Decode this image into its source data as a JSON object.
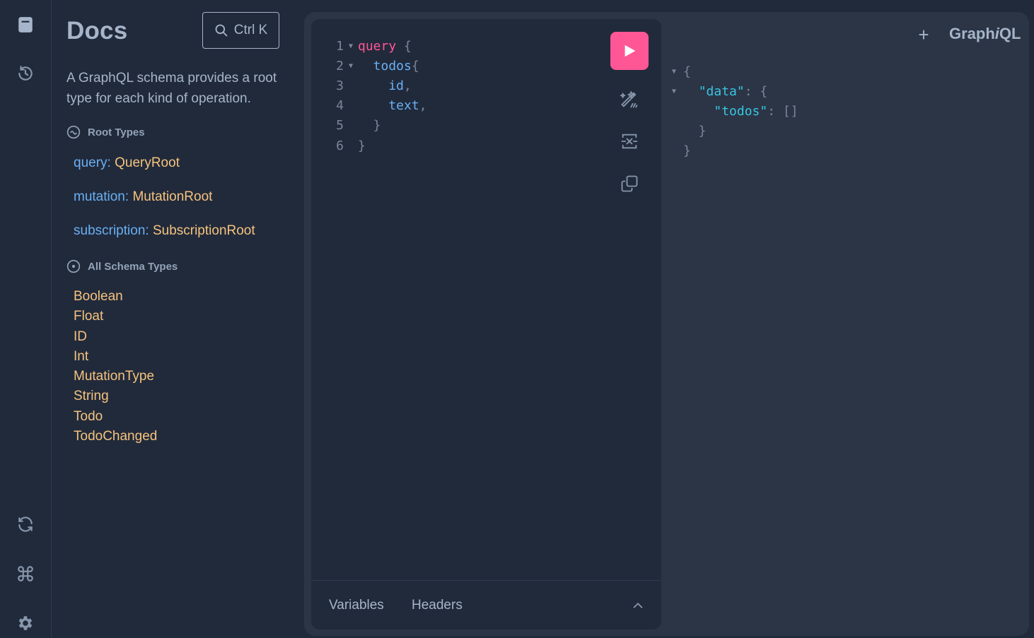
{
  "rail": {
    "top_icons": [
      "docs-icon",
      "history-icon"
    ],
    "bottom_icons": [
      "refetch-schema-icon",
      "shortcuts-icon",
      "settings-icon"
    ]
  },
  "docs": {
    "title": "Docs",
    "search_shortcut": "Ctrl K",
    "description": "A GraphQL schema provides a root type for each kind of operation.",
    "root_types_heading": "Root Types",
    "root_types": [
      {
        "key": "query:",
        "type": "QueryRoot"
      },
      {
        "key": "mutation:",
        "type": "MutationRoot"
      },
      {
        "key": "subscription:",
        "type": "SubscriptionRoot"
      }
    ],
    "all_types_heading": "All Schema Types",
    "all_types": [
      "Boolean",
      "Float",
      "ID",
      "Int",
      "MutationType",
      "String",
      "Todo",
      "TodoChanged"
    ]
  },
  "editor": {
    "lines": [
      {
        "n": "1",
        "text": "query {"
      },
      {
        "n": "2",
        "text": "  todos{"
      },
      {
        "n": "3",
        "text": "    id,"
      },
      {
        "n": "4",
        "text": "    text,"
      },
      {
        "n": "5",
        "text": "  }"
      },
      {
        "n": "6",
        "text": "}"
      }
    ],
    "footer_tabs": {
      "variables": "Variables",
      "headers": "Headers"
    }
  },
  "result": {
    "lines": [
      "{",
      "  \"data\": {",
      "    \"todos\": []",
      "  }",
      "}"
    ]
  },
  "header": {
    "add_tab": "+",
    "logo_prefix": "Graph",
    "logo_italic": "i",
    "logo_suffix": "QL"
  },
  "colors": {
    "accent": "#ff5795",
    "field": "#6ab0f3",
    "type": "#f5c37e",
    "string": "#37c5e0"
  }
}
